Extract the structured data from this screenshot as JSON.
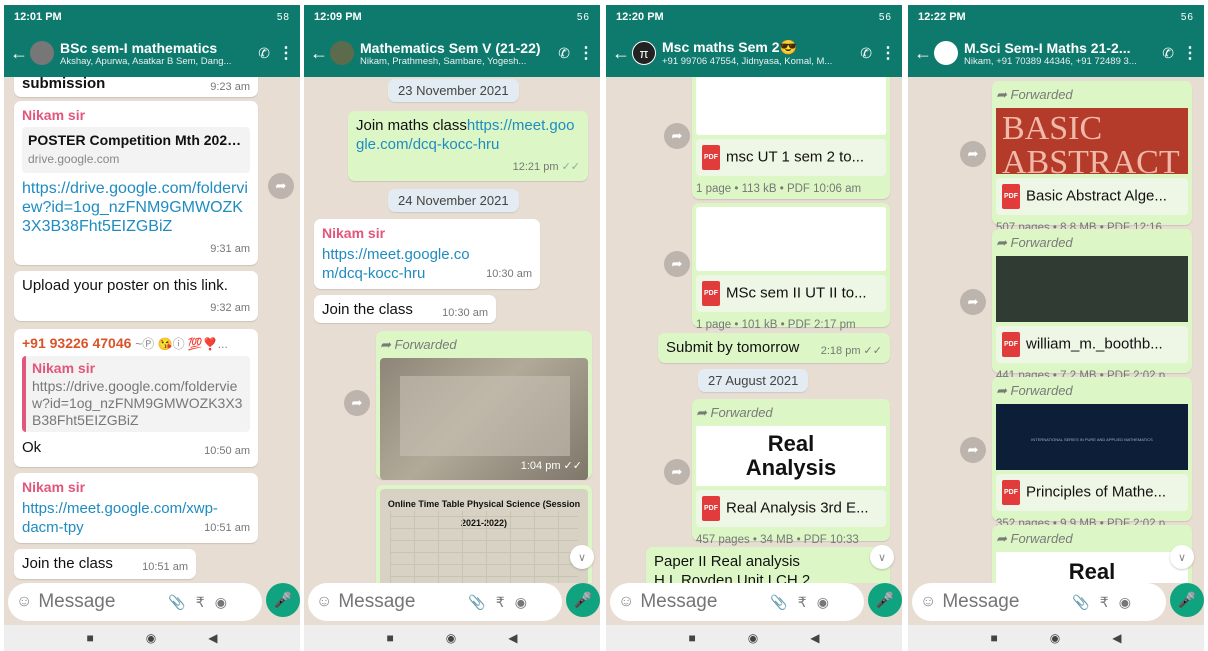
{
  "screens": [
    {
      "status_time": "12:01 PM",
      "status_icons": "58",
      "title": "BSc sem-I mathematics",
      "subtitle": "Akshay, Apurwa, Asatkar B Sem, Dang...",
      "messages": {
        "m1": {
          "text": "submission",
          "time": "9:23 am"
        },
        "m2": {
          "sender": "Nikam sir",
          "doc_title": "POSTER Competition Mth 2021...",
          "doc_domain": "drive.google.com",
          "link": "https://drive.google.com/folderview?id=1og_nzFNM9GMWOZK3X3B38Fht5EIZGBiZ",
          "time": "9:31 am"
        },
        "m3": {
          "text": "Upload your poster on this link.",
          "time": "9:32 am"
        },
        "m4": {
          "sender": "+91 93226 47046",
          "sender_extra": "~Ⓟ 😘ⓘ 💯❣️...",
          "quote_sender": "Nikam sir",
          "quote_text": "https://drive.google.com/folderview?id=1og_nzFNM9GMWOZK3X3B38Fht5EIZGBiZ",
          "text": "Ok",
          "time": "10:50 am"
        },
        "m5": {
          "sender": "Nikam sir",
          "link": "https://meet.google.com/xwp-dacm-tpy",
          "time": "10:51 am"
        },
        "m6": {
          "text": "Join the class",
          "time": "10:51 am"
        }
      }
    },
    {
      "status_time": "12:09 PM",
      "status_icons": "56",
      "title": "Mathematics Sem V (21-22)",
      "subtitle": "Nikam, Prathmesh, Sambare, Yogesh...",
      "date1": "23 November 2021",
      "date2": "24 November 2021",
      "messages": {
        "m1": {
          "text": "Join maths class",
          "link": "https://meet.google.com/dcq-kocc-hru",
          "time": "12:21 pm"
        },
        "m2": {
          "sender": "Nikam sir",
          "link": "https://meet.google.com/dcq-kocc-hru",
          "time": "10:30 am"
        },
        "m3": {
          "text": "Join the class",
          "time": "10:30 am"
        },
        "m4": {
          "forwarded": "Forwarded",
          "time": "1:04 pm"
        },
        "m5": {
          "table_title": "Online Time Table Physical Science (Session 2021-2022)"
        }
      }
    },
    {
      "status_time": "12:20 PM",
      "status_icons": "56",
      "title": "Msc maths Sem 2😎",
      "subtitle": "+91 99706 47554, Jidnyasa, Komal, M...",
      "date1": "27 August 2021",
      "messages": {
        "m1": {
          "doc": "msc UT 1 sem 2 to...",
          "meta": "1 page • 113 kB • PDF  10:06 am"
        },
        "m2": {
          "doc": "MSc sem II UT II to...",
          "meta": "1 page • 101 kB • PDF  2:17 pm"
        },
        "m3": {
          "text": "Submit by tomorrow",
          "time": "2:18 pm"
        },
        "m4": {
          "forwarded": "Forwarded",
          "cover_line1": "Real",
          "cover_line2": "Analysis",
          "doc": "Real Analysis 3rd E...",
          "meta": "457 pages • 34 MB • PDF  10:33"
        },
        "m5": {
          "text": "Paper II Real analysis",
          "text2": "H.L Royden Unit I CH 2"
        }
      }
    },
    {
      "status_time": "12:22 PM",
      "status_icons": "56",
      "title": "M.Sci Sem-I Maths 21-2...",
      "subtitle": "Nikam, +91 70389 44346, +91 72489 3...",
      "messages": {
        "m1": {
          "forwarded": "Forwarded",
          "cover": "BASIC",
          "cover2": "ABSTRACT",
          "doc": "Basic Abstract Alge...",
          "meta": "507 pages • 8.8 MB • PDF  12:16"
        },
        "m2": {
          "forwarded": "Forwarded",
          "doc": "william_m._boothb...",
          "meta": "441 pages • 7.2 MB • PDF  2:02 p"
        },
        "m3": {
          "forwarded": "Forwarded",
          "cover": "INTERNATIONAL SERIES IN PURE AND APPLIED MATHEMATICS",
          "doc": "Principles of Mathe...",
          "meta": "352 pages • 9.9 MB • PDF  2:02 p"
        },
        "m4": {
          "forwarded": "Forwarded",
          "cover": "Real"
        }
      }
    }
  ],
  "composer": {
    "placeholder": "Message"
  },
  "colors": {
    "header": "#0e7a6d",
    "wallpaper": "#e7ddd3",
    "outgoing": "#dcf7c5",
    "link": "#1f8cc0",
    "mic": "#0fa37f"
  },
  "icons": [
    "back-arrow-icon",
    "call-add-icon",
    "more-vert-icon",
    "emoji-icon",
    "attach-icon",
    "payment-icon",
    "camera-icon",
    "mic-icon",
    "forward-share-icon",
    "pdf-icon",
    "scroll-down-icon",
    "nav-square-icon",
    "nav-circle-icon",
    "nav-back-icon"
  ]
}
